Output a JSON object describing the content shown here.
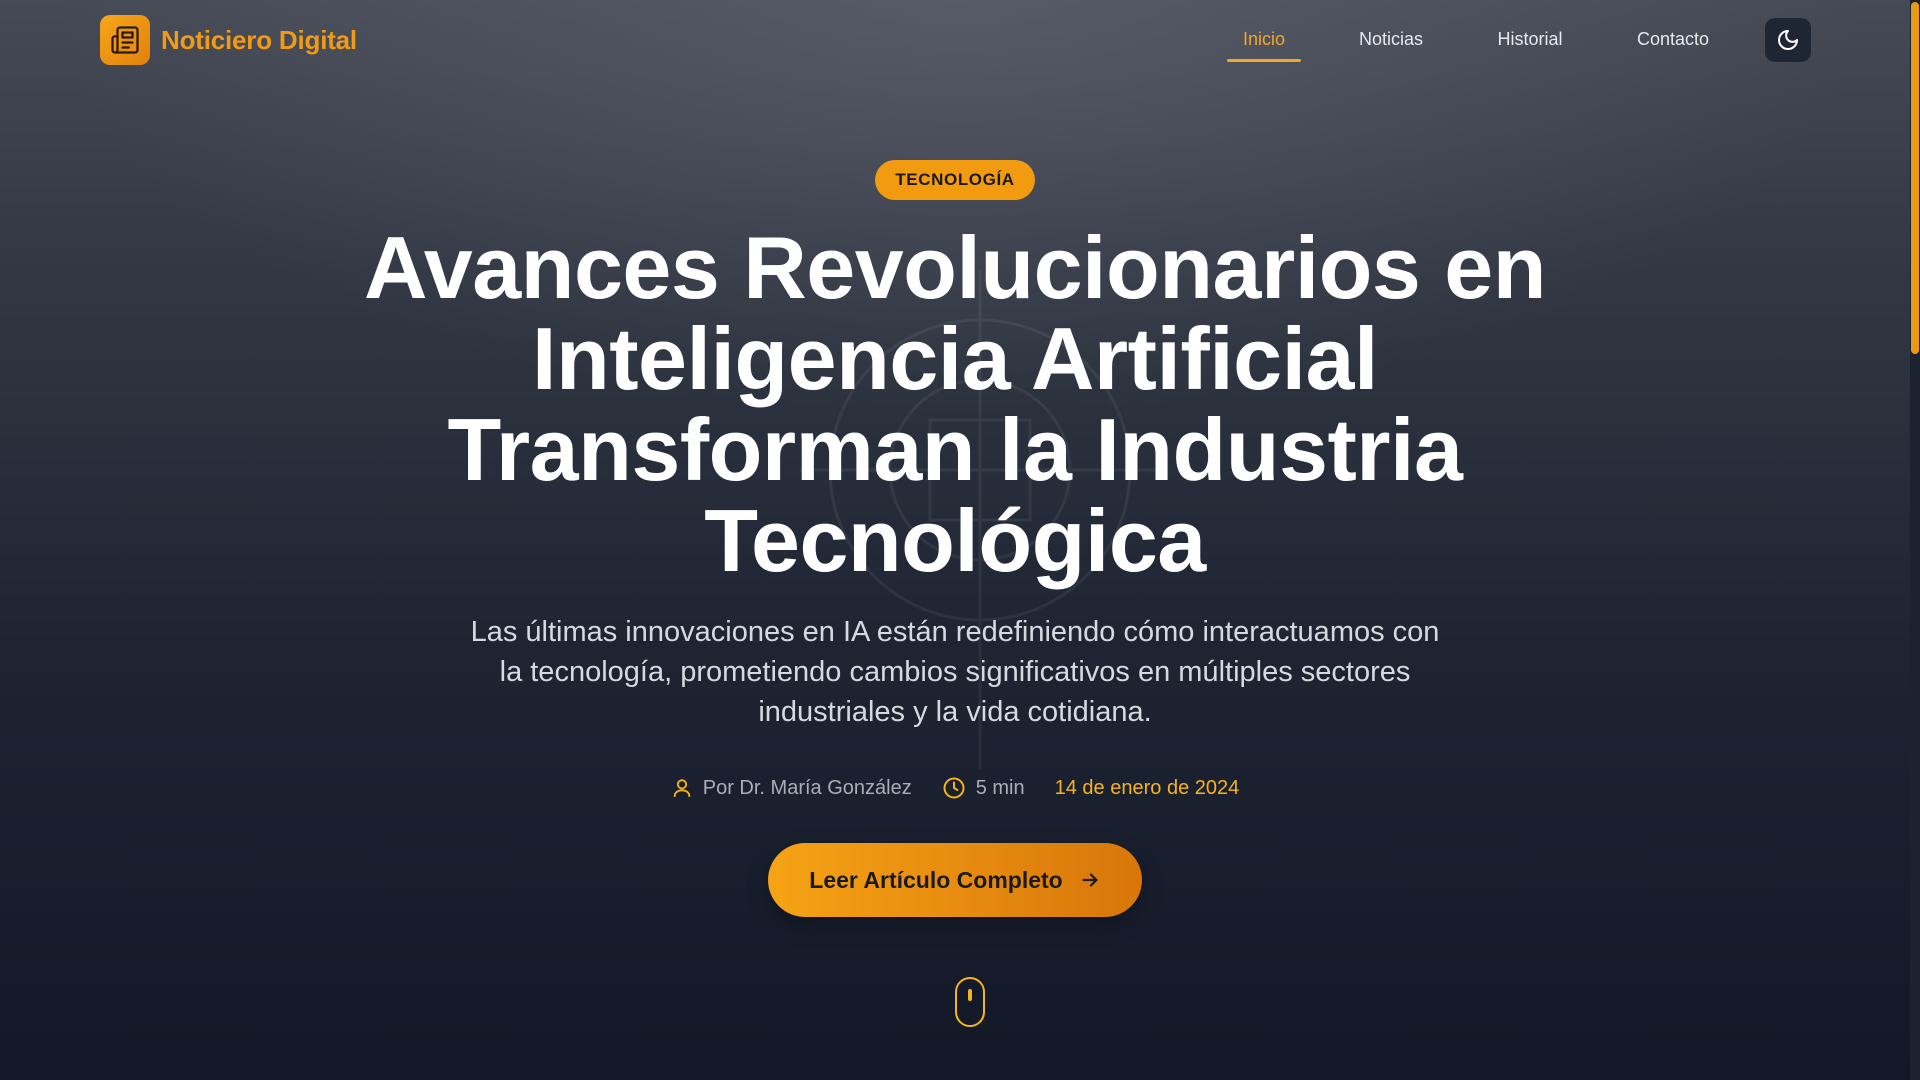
{
  "site": {
    "name": "Noticiero Digital",
    "logo_icon": "newspaper-icon",
    "accent_color": "#f29b11"
  },
  "nav": {
    "items": [
      {
        "label": "Inicio",
        "active": true
      },
      {
        "label": "Noticias",
        "active": false
      },
      {
        "label": "Historial",
        "active": false
      },
      {
        "label": "Contacto",
        "active": false
      }
    ],
    "theme_toggle_icon": "moon-icon"
  },
  "hero": {
    "category": "TECNOLOGÍA",
    "title": "Avances Revolucionarios en Inteligencia Artificial Transforman la Industria Tecnológica",
    "subtitle": "Las últimas innovaciones en IA están redefiniendo cómo interactuamos con la tecnología, prometiendo cambios significativos en múltiples sectores industriales y la vida cotidiana.",
    "meta": {
      "author": "Por Dr. María González",
      "author_icon": "user-icon",
      "read_time": "5 min",
      "read_time_icon": "clock-icon",
      "date": "14 de enero de 2024"
    },
    "cta": {
      "label": "Leer Artículo Completo",
      "icon": "arrow-right-icon"
    },
    "scroll_indicator_icon": "mouse-icon"
  }
}
